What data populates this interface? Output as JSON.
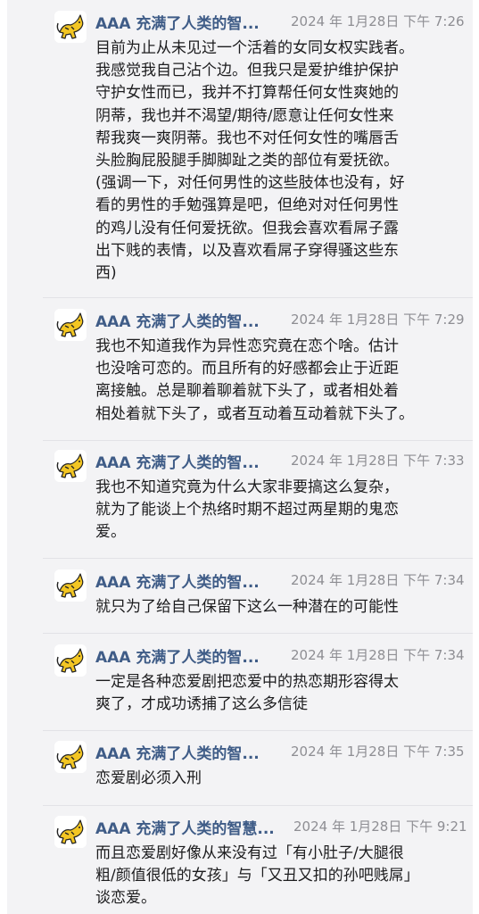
{
  "messages": [
    {
      "name": "AAA 充满了人类的智...",
      "time": "2024 年 1月28日 下午 7:26",
      "text": "目前为止从未见过一个活着的女同女权实践者。\n我感觉我自己沾个边。但我只是爱护维护保护\n守护女性而已，我并不打算帮任何女性爽她的\n阴蒂，我也并不渴望/期待/愿意让任何女性来\n帮我爽一爽阴蒂。我也不对任何女性的嘴唇舌\n头脸胸屁股腿手脚脚趾之类的部位有爱抚欲。\n(强调一下，对任何男性的这些肢体也没有，好\n看的男性的手勉强算是吧，但绝对对任何男性\n的鸡儿没有任何爱抚欲。但我会喜欢看屌子露\n出下贱的表情，以及喜欢看屌子穿得骚这些东\n西)"
    },
    {
      "name": "AAA 充满了人类的智...",
      "time": "2024 年 1月28日 下午 7:29",
      "text": "我也不知道我作为异性恋究竟在恋个啥。估计\n也没啥可恋的。而且所有的好感都会止于近距\n离接触。总是聊着聊着就下头了，或者相处着\n相处着就下头了，或者互动着互动着就下头了。"
    },
    {
      "name": "AAA 充满了人类的智...",
      "time": "2024 年 1月28日 下午 7:33",
      "text": "我也不知道究竟为什么大家非要搞这么复杂，\n就为了能谈上个热络时期不超过两星期的鬼恋\n爱。"
    },
    {
      "name": "AAA 充满了人类的智...",
      "time": "2024 年 1月28日 下午 7:34",
      "text": "就只为了给自己保留下这么一种潜在的可能性"
    },
    {
      "name": "AAA 充满了人类的智...",
      "time": "2024 年 1月28日 下午 7:34",
      "text": "一定是各种恋爱剧把恋爱中的热恋期形容得太\n爽了，才成功诱捕了这么多信徒"
    },
    {
      "name": "AAA 充满了人类的智...",
      "time": "2024 年 1月28日 下午 7:35",
      "text": "恋爱剧必须入刑"
    },
    {
      "name": "AAA 充满了人类的智慧...",
      "time": "2024 年 1月28日 下午 9:21",
      "text": "而且恋爱剧好像从来没有过「有小肚子/大腿很\n粗/颜值很低的女孩」与「又丑又扣的孙吧贱屌」\n谈恋爱。"
    }
  ]
}
